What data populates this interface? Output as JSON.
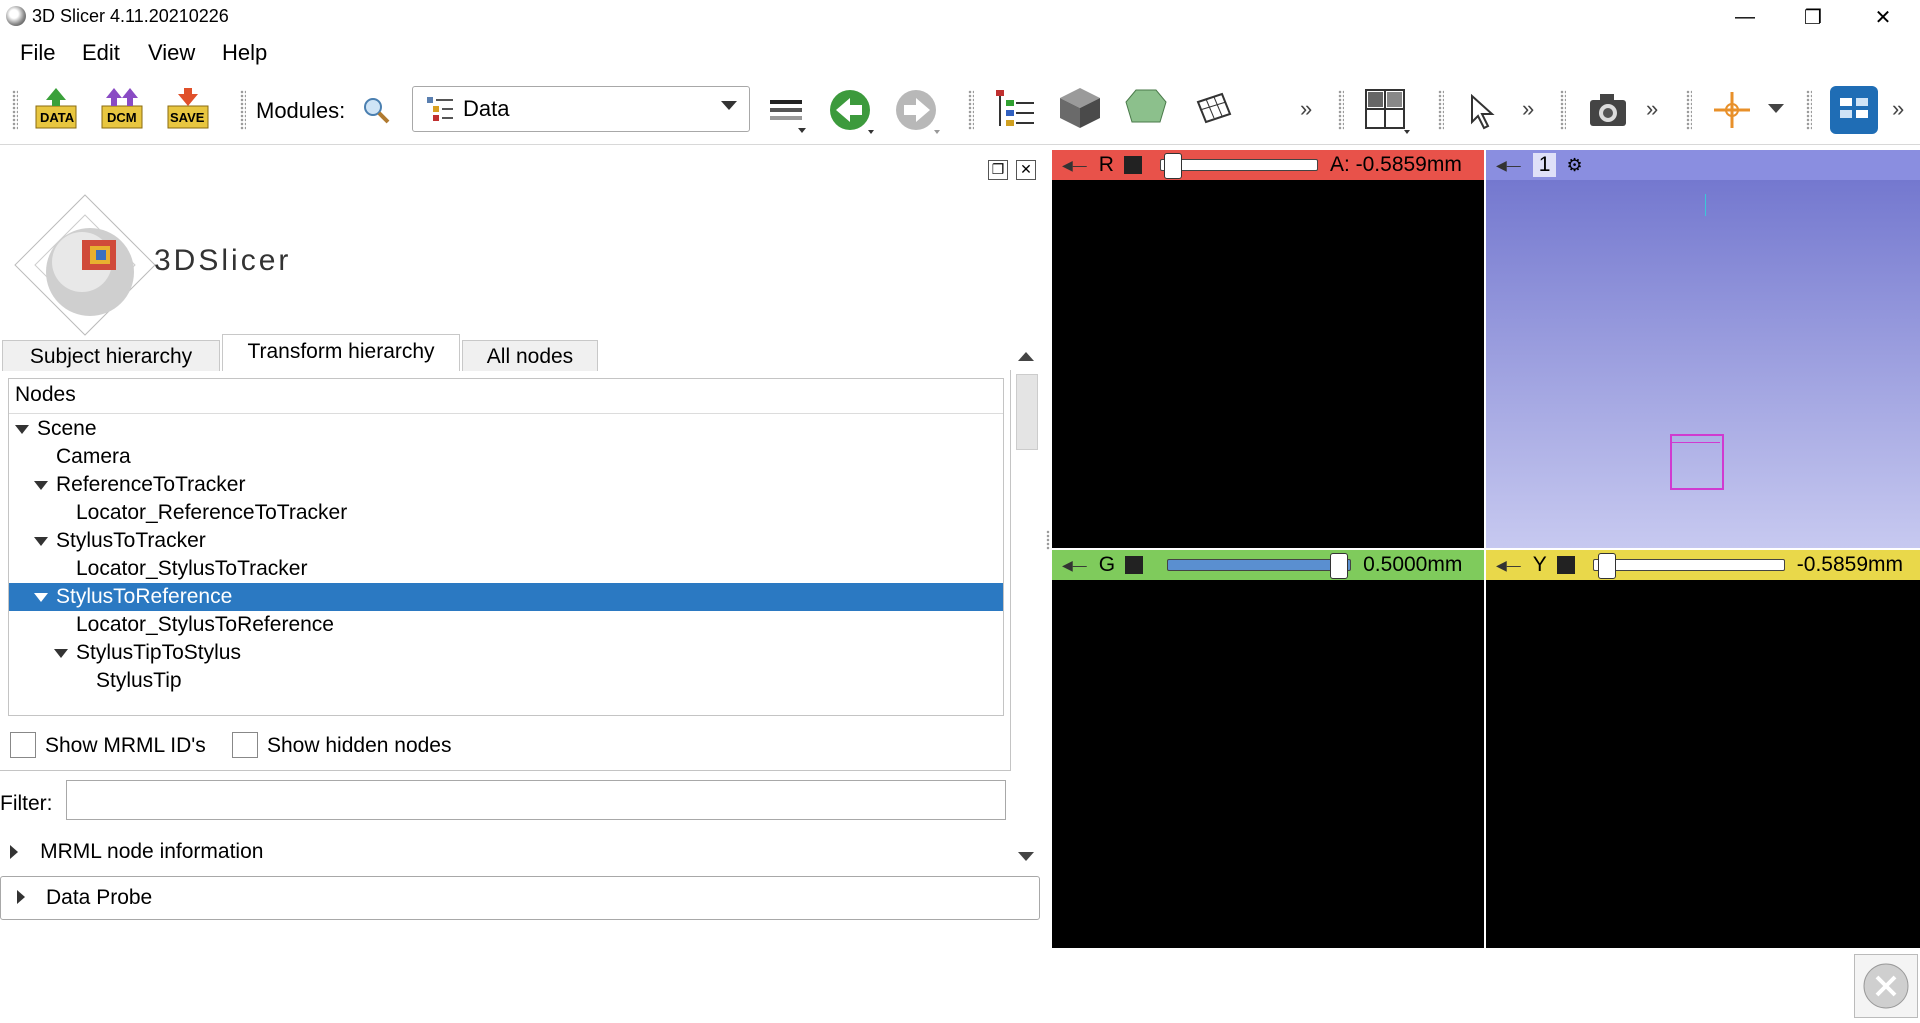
{
  "window": {
    "title": "3D Slicer 4.11.20210226",
    "controls": [
      "minimize-icon",
      "restore-icon",
      "close-icon"
    ]
  },
  "menu": [
    "File",
    "Edit",
    "View",
    "Help"
  ],
  "toolbar": {
    "data_btn": "DATA",
    "dcm_btn": "DCM",
    "save_btn": "SAVE",
    "modules_label": "Modules:",
    "module_selected": "Data",
    "more": "»"
  },
  "logo": {
    "text": "3DSlicer"
  },
  "tabs": [
    "Subject hierarchy",
    "Transform hierarchy",
    "All nodes"
  ],
  "tree": {
    "header": "Nodes",
    "rows": [
      {
        "label": "Scene",
        "level": 0,
        "expanded": true
      },
      {
        "label": "Camera",
        "level": 1,
        "expanded": null
      },
      {
        "label": "ReferenceToTracker",
        "level": 1,
        "expanded": true
      },
      {
        "label": "Locator_ReferenceToTracker",
        "level": 2,
        "expanded": null
      },
      {
        "label": "StylusToTracker",
        "level": 1,
        "expanded": true
      },
      {
        "label": "Locator_StylusToTracker",
        "level": 2,
        "expanded": null
      },
      {
        "label": "StylusToReference",
        "level": 1,
        "expanded": true,
        "selected": true
      },
      {
        "label": "Locator_StylusToReference",
        "level": 2,
        "expanded": null
      },
      {
        "label": "StylusTipToStylus",
        "level": 2,
        "expanded": true
      },
      {
        "label": "StylusTip",
        "level": 3,
        "expanded": null
      }
    ]
  },
  "options": {
    "show_ids": "Show MRML ID's",
    "show_hidden": "Show hidden nodes"
  },
  "filter": {
    "label": "Filter:",
    "value": ""
  },
  "sections": {
    "mrml_info": "MRML node information",
    "data_probe": "Data Probe"
  },
  "views": {
    "red": {
      "letter": "R",
      "offset": "A: -0.5859mm",
      "color": "#e8524a",
      "slider_fraction": 0.03
    },
    "threed": {
      "label": "1",
      "color": "#8a8ee0"
    },
    "green": {
      "letter": "G",
      "offset": "0.5000mm",
      "color": "#7fcb5c",
      "slider_fraction": 0.97
    },
    "yellow": {
      "letter": "Y",
      "offset": "-0.5859mm",
      "color": "#e9d84a",
      "slider_fraction": 0.03
    }
  }
}
